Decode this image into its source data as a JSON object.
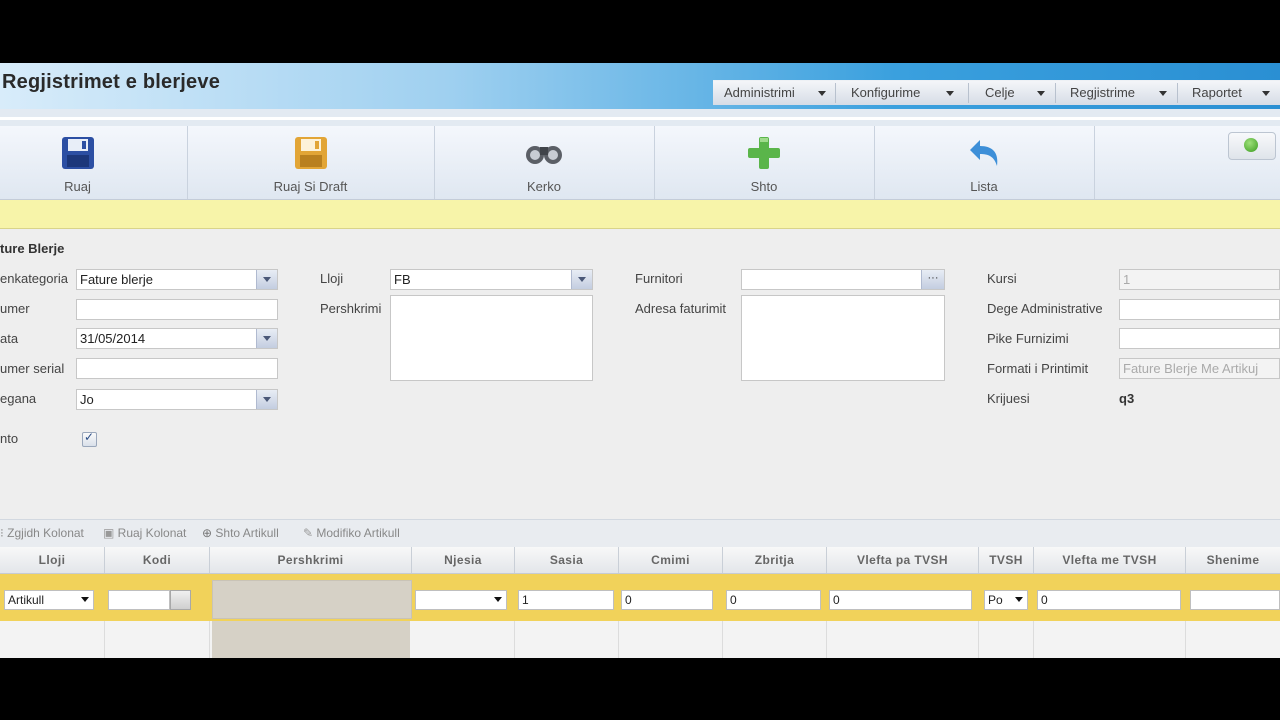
{
  "header": {
    "title": "Regjistrimet e blerjeve",
    "menu": [
      "Administrimi",
      "Konfigurime",
      "Celje",
      "Regjistrime",
      "Raportet"
    ]
  },
  "toolbar": {
    "save": "Ruaj",
    "save_draft": "Ruaj Si Draft",
    "search": "Kerko",
    "add": "Shto",
    "list": "Lista"
  },
  "form": {
    "section_title": "ture Blerje",
    "col1": {
      "nenkategoria_label": "enkategoria",
      "nenkategoria_value": "Fature blerje",
      "numer_label": "umer",
      "numer_value": "",
      "data_label": "ata",
      "data_value": "31/05/2014",
      "numer_serial_label": "umer serial",
      "numer_serial_value": "",
      "pagana_label": "egana",
      "pagana_value": "Jo",
      "aktivo_label": "nto"
    },
    "col2": {
      "lloji_label": "Lloji",
      "lloji_value": "FB",
      "pershkrimi_label": "Pershkrimi"
    },
    "col3": {
      "furnitori_label": "Furnitori",
      "furnitori_value": "",
      "adresa_label": "Adresa faturimit"
    },
    "col4": {
      "kursi_label": "Kursi",
      "kursi_value": "1",
      "dege_label": "Dege Administrative",
      "dege_value": "",
      "pike_label": "Pike Furnizimi",
      "pike_value": "",
      "formati_label": "Formati i Printimit",
      "formati_value": "Fature Blerje Me Artikuj",
      "krijuesi_label": "Krijuesi",
      "krijuesi_value": "q3"
    }
  },
  "grid_tools": {
    "choose_columns": "Zgjidh Kolonat",
    "save_columns": "Ruaj Kolonat",
    "add_item": "Shto Artikull",
    "edit_item": "Modifiko Artikull"
  },
  "grid": {
    "columns": [
      "Lloji",
      "Kodi",
      "Pershkrimi",
      "Njesia",
      "Sasia",
      "Cmimi",
      "Zbritja",
      "Vlefta pa TVSH",
      "TVSH",
      "Vlefta me TVSH",
      "Shenime"
    ],
    "edit_row": {
      "lloji": "Artikull",
      "kodi": "",
      "njesia": "",
      "sasia": "1",
      "cmimi": "0",
      "zbritja": "0",
      "vlefta_pa_tvsh": "0",
      "tvsh": "Po",
      "vlefta_me_tvsh": "0",
      "shenime": ""
    }
  },
  "colors": {
    "yellow_bar": "#f7f4a9",
    "edit_row": "#f1d25a",
    "header_blue": "#2a8fd3"
  }
}
